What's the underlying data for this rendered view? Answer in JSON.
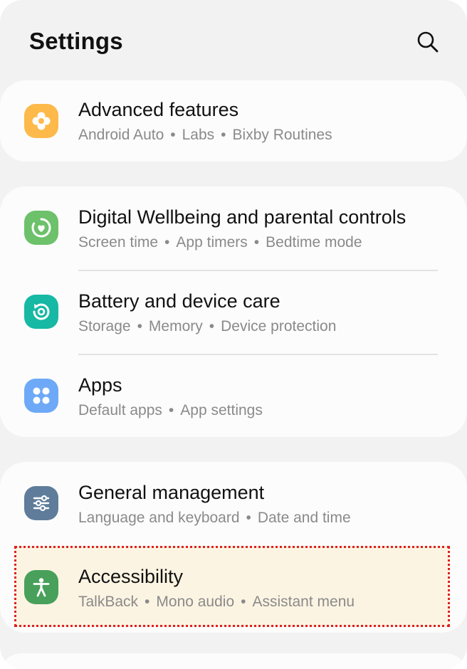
{
  "header": {
    "title": "Settings",
    "search_icon": "search-icon"
  },
  "colors": {
    "advanced": "#fdb94a",
    "wellbeing": "#6cc16a",
    "battery": "#17b8a4",
    "apps": "#6ea9f7",
    "general": "#5f7d9a",
    "accessibility": "#48a05a",
    "highlight_border": "#e02020"
  },
  "items": {
    "advanced": {
      "title": "Advanced features",
      "sub": [
        "Android Auto",
        "Labs",
        "Bixby Routines"
      ],
      "icon": "puzzle-flower-icon"
    },
    "wellbeing": {
      "title": "Digital Wellbeing and parental controls",
      "sub": [
        "Screen time",
        "App timers",
        "Bedtime mode"
      ],
      "icon": "heart-ring-icon"
    },
    "battery": {
      "title": "Battery and device care",
      "sub": [
        "Storage",
        "Memory",
        "Device protection"
      ],
      "icon": "device-care-icon"
    },
    "apps": {
      "title": "Apps",
      "sub": [
        "Default apps",
        "App settings"
      ],
      "icon": "four-dots-icon"
    },
    "general": {
      "title": "General management",
      "sub": [
        "Language and keyboard",
        "Date and time"
      ],
      "icon": "sliders-icon"
    },
    "accessibility": {
      "title": "Accessibility",
      "sub": [
        "TalkBack",
        "Mono audio",
        "Assistant menu"
      ],
      "icon": "person-icon"
    }
  },
  "separator": "•"
}
